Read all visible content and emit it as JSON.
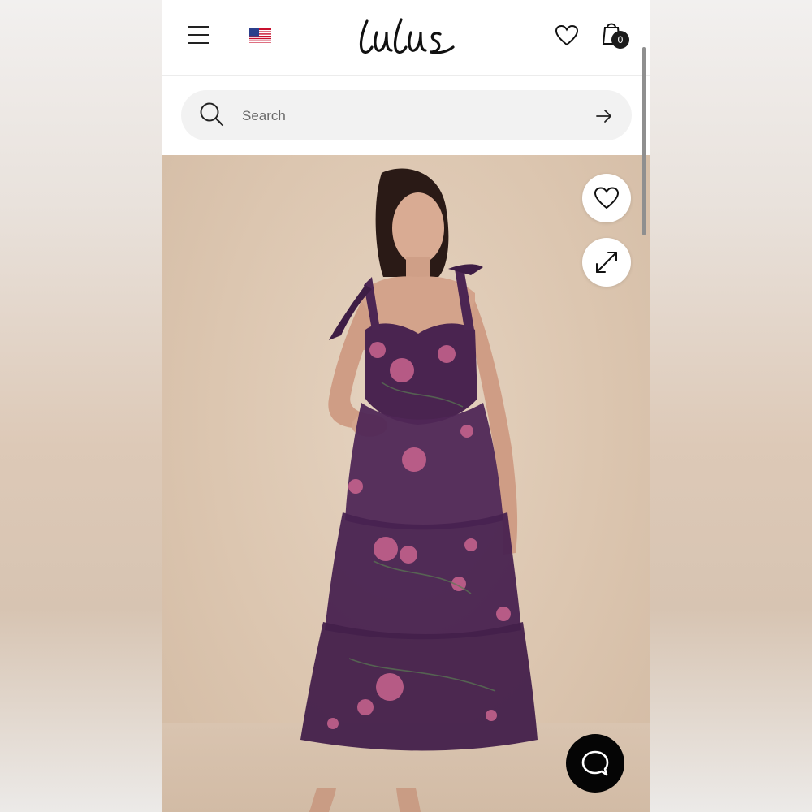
{
  "header": {
    "logo_text": "lulus",
    "cart_count": "0",
    "flag": "us-flag-icon",
    "icons": [
      "menu-icon",
      "heart-icon",
      "shopping-bag-icon"
    ]
  },
  "search": {
    "placeholder": "Search",
    "value": ""
  },
  "hero": {
    "image_alt": "",
    "icons": [
      "heart-icon",
      "expand-icon"
    ],
    "background_color": "#dcc6b0"
  },
  "chat": {
    "icon": "chat-bubble-icon"
  },
  "colors": {
    "text": "#222222",
    "badge": "#1b1b1b",
    "search_bg": "#f2f2f2",
    "dress_purple": "#4a2450",
    "rose_pink": "#c9648f"
  }
}
